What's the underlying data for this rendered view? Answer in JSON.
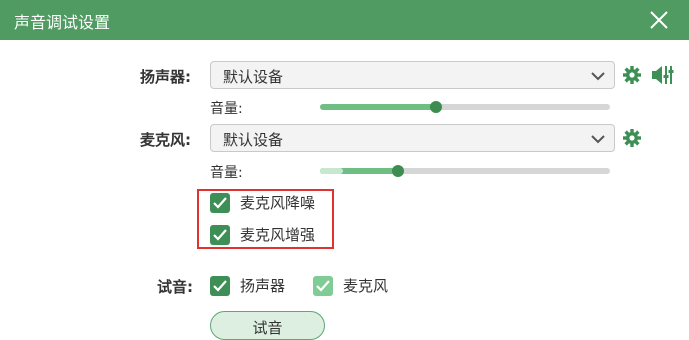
{
  "window": {
    "title": "声音调试设置"
  },
  "speaker": {
    "label": "扬声器:",
    "device": "默认设备",
    "volume_label": "音量:",
    "volume_level": 0.4
  },
  "microphone": {
    "label": "麦克风:",
    "device": "默认设备",
    "volume_label": "音量:",
    "volume_level": 0.27,
    "input_level": 0.08,
    "noise_reduction": {
      "label": "麦克风降噪",
      "checked": true
    },
    "enhancement": {
      "label": "麦克风增强",
      "checked": true
    }
  },
  "test": {
    "label": "试音:",
    "speaker_option": {
      "label": "扬声器",
      "checked": true
    },
    "mic_option": {
      "label": "麦克风",
      "checked": true
    },
    "button_label": "试音"
  },
  "icons": [
    "close-icon",
    "chevron-down-icon",
    "gear-icon",
    "speaker-adjust-icon",
    "checkmark-icon"
  ],
  "colors": {
    "titlebar": "#4f9b62",
    "accent": "#3e8f55",
    "slider_fill": "#6fbf84",
    "highlight_box": "#e0322f"
  }
}
